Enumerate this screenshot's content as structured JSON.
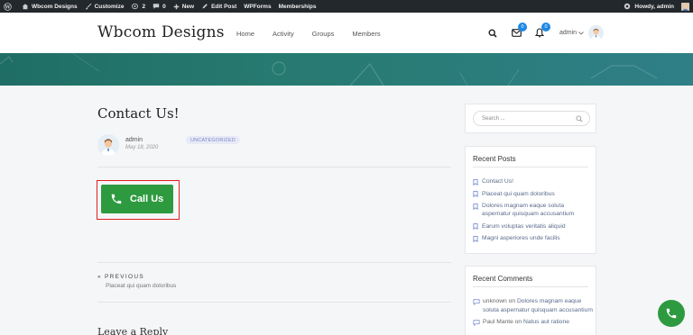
{
  "admin_bar": {
    "site_name": "Wbcom Designs",
    "customize": "Customize",
    "updates_count": "2",
    "comments_count": "0",
    "new": "New",
    "edit_post": "Edit Post",
    "wpforms": "WPForms",
    "memberships": "Memberships",
    "howdy": "Howdy, admin"
  },
  "header": {
    "logo": "Wbcom Designs",
    "nav": [
      "Home",
      "Activity",
      "Groups",
      "Members"
    ],
    "messages_count": "0",
    "notifications_count": "0",
    "user_label": "admin"
  },
  "post": {
    "title": "Contact Us!",
    "author": "admin",
    "date": "May 18, 2020",
    "category": "UNCATEGORIZED",
    "call_button_label": "Call Us",
    "previous_label": "PREVIOUS",
    "previous_title": "Placeat qui quam doloribus",
    "reply_heading": "Leave a Reply"
  },
  "sidebar": {
    "search_placeholder": "Search ...",
    "recent_posts_title": "Recent Posts",
    "recent_posts": [
      "Contact Us!",
      "Placeat qui quam doloribus",
      "Dolores magnam eaque soluta aspernatur quisquam accusantium",
      "Earum voluptas veritatis aliquid",
      "Magni asperiores unde facilis"
    ],
    "recent_comments_title": "Recent Comments",
    "recent_comments": [
      {
        "author": "unknown",
        "on": "on",
        "post": "Dolores magnam eaque soluta aspernatur quisquam accusantium"
      },
      {
        "author": "Paul Mante",
        "on": "on",
        "post": "Natus aut ratione"
      }
    ]
  },
  "colors": {
    "admin_bar": "#23282d",
    "banner": "#277a70",
    "call_green": "#2e9a3f",
    "highlight_red": "#e0201f",
    "badge_blue": "#1e88e5"
  }
}
